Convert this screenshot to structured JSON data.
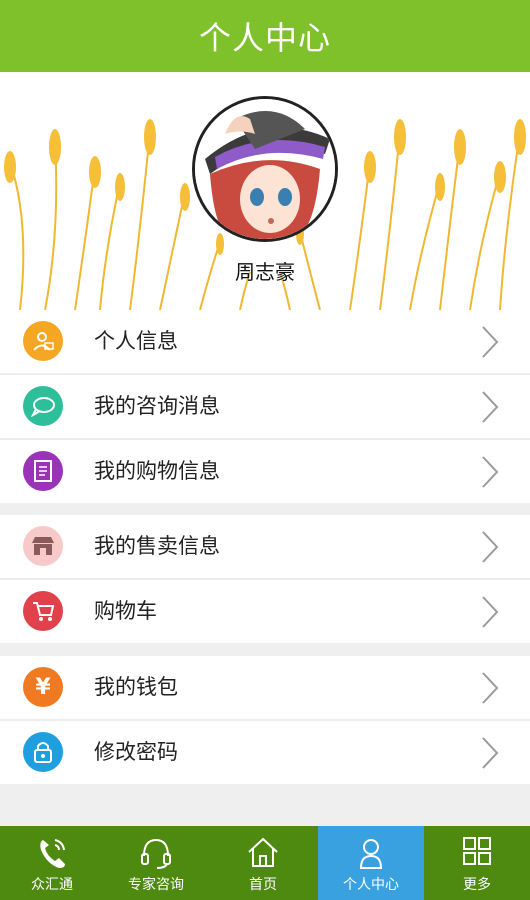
{
  "header": {
    "title": "个人中心"
  },
  "profile": {
    "name": "周志豪"
  },
  "menu": {
    "group1": [
      {
        "label": "个人信息",
        "icon": "person-card-icon",
        "color": "#f5a623"
      },
      {
        "label": "我的咨询消息",
        "icon": "chat-bubble-icon",
        "color": "#2cbf9a"
      },
      {
        "label": "我的购物信息",
        "icon": "document-list-icon",
        "color": "#9b33b8"
      }
    ],
    "group2": [
      {
        "label": "我的售卖信息",
        "icon": "shop-icon",
        "color": "#f8c9c9"
      },
      {
        "label": "购物车",
        "icon": "cart-icon",
        "color": "#e0414a"
      }
    ],
    "group3": [
      {
        "label": "我的钱包",
        "icon": "yen-coin-icon",
        "color": "#f07a22"
      },
      {
        "label": "修改密码",
        "icon": "lock-icon",
        "color": "#1f9ee0"
      }
    ]
  },
  "tabs": [
    {
      "label": "众汇通",
      "icon": "phone-icon"
    },
    {
      "label": "专家咨询",
      "icon": "headset-icon"
    },
    {
      "label": "首页",
      "icon": "home-icon"
    },
    {
      "label": "个人中心",
      "icon": "user-icon",
      "active": true
    },
    {
      "label": "更多",
      "icon": "grid-icon"
    }
  ],
  "colors": {
    "header": "#7ec12a",
    "tabbar": "#4f8a10",
    "active_tab": "#3aa1e0",
    "wheat": "#f0b429"
  }
}
